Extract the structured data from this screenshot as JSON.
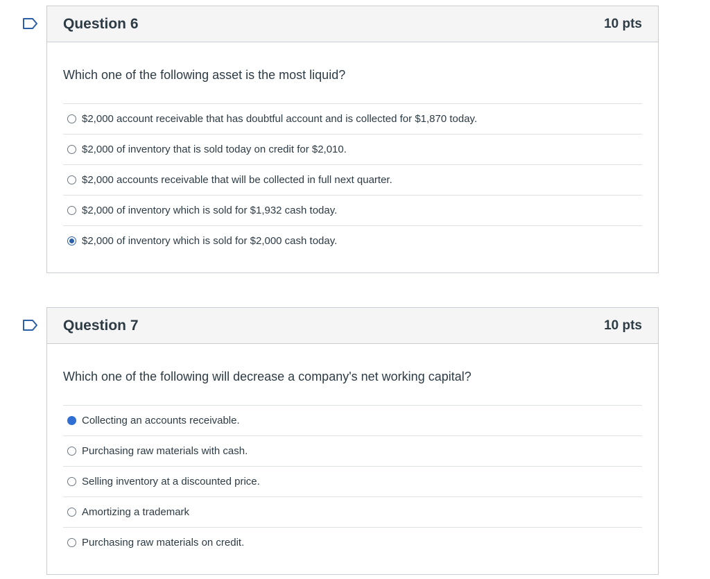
{
  "questions": [
    {
      "title": "Question 6",
      "points": "10 pts",
      "text": "Which one of the following asset is the most liquid?",
      "answers": [
        "$2,000 account receivable that has doubtful account and is collected for $1,870 today.",
        "$2,000 of inventory that is sold today on credit for $2,010.",
        "$2,000 accounts receivable that will be collected in full next quarter.",
        "$2,000 of inventory which is sold for $1,932 cash today.",
        "$2,000 of inventory which is sold for $2,000 cash today."
      ],
      "selected_index": 4
    },
    {
      "title": "Question 7",
      "points": "10 pts",
      "text": "Which one of the following will decrease a company's net working capital?",
      "answers": [
        "Collecting an accounts receivable.",
        "Purchasing raw materials with cash.",
        "Selling inventory at a discounted price.",
        "Amortizing a trademark",
        "Purchasing raw materials on credit."
      ],
      "selected_index": 0
    }
  ],
  "colors": {
    "accent": "#2b5fa8",
    "text": "#2d3b45",
    "border": "#c7cdd1",
    "header_bg": "#f5f5f5"
  },
  "icons": {
    "flag": "flag-outline-icon"
  }
}
